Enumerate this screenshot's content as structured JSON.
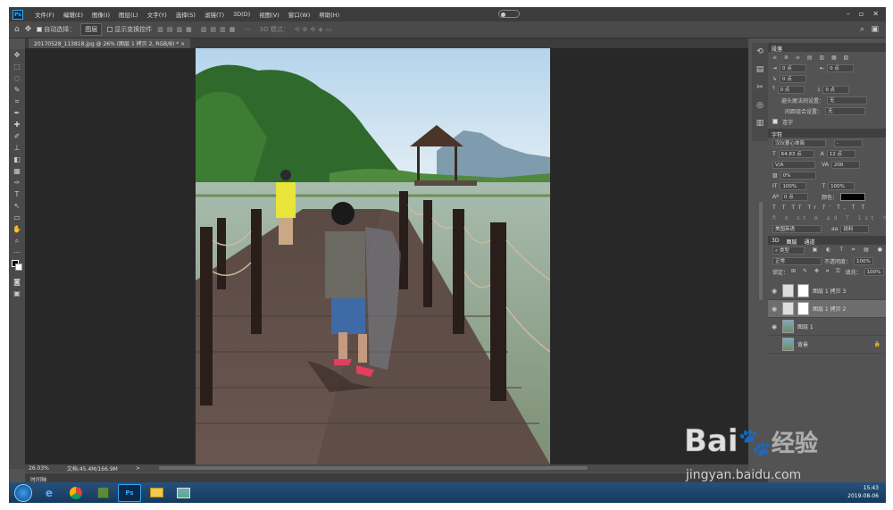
{
  "menubar": {
    "logo": "Ps",
    "items": [
      "文件(F)",
      "编辑(E)",
      "图像(I)",
      "图层(L)",
      "文字(Y)",
      "选择(S)",
      "滤镜(T)",
      "3D(D)",
      "视图(V)",
      "窗口(W)",
      "帮助(H)"
    ],
    "window_controls": [
      "–",
      "▫",
      "✕"
    ]
  },
  "options": {
    "auto_select_label": "自动选择：",
    "auto_select_value": "图层",
    "transform_label": "显示变换控件",
    "mode3d": "3D 模式："
  },
  "document": {
    "tab_title": "20170528_113818.jpg @ 26% (图层 1 拷贝 2, RGB/8) *",
    "close": "×"
  },
  "status": {
    "zoom": "26.03%",
    "doc_info": "文档:45.4M/166.9M",
    "arrow": ">"
  },
  "timeline": {
    "label": "时间轴"
  },
  "paragraph": {
    "title": "段落",
    "indent_left": "0 点",
    "indent_right": "0 点",
    "first_line": "0 点",
    "space_before": "0 点",
    "space_after": "0 点",
    "avoid_label": "避头尾法则设置：",
    "avoid_value": "无",
    "spacing_label": "间距组合设置：",
    "spacing_value": "无",
    "hyphen_label": "连字"
  },
  "character": {
    "title": "字符",
    "font_family": "汉仪菱心体简",
    "font_style": "-",
    "size": "64.83 点",
    "leading": "12 点",
    "kerning": "V/A",
    "tracking": "200",
    "scale_pct": "0%",
    "vscale": "100%",
    "hscale": "100%",
    "baseline": "0 点",
    "color_label": "颜色：",
    "language": "美国英语",
    "antialias": "锐利",
    "glyphs": [
      "T",
      "T",
      "TT",
      "Tr",
      "T'",
      "T,",
      "T",
      "T"
    ]
  },
  "layers_panel": {
    "tabs": [
      "3D",
      "图层",
      "通道"
    ],
    "filter_label": "类型",
    "blend_mode": "正常",
    "opacity_label": "不透明度：",
    "opacity": "100%",
    "lock_label": "锁定：",
    "fill_label": "填充：",
    "fill": "100%",
    "layers": [
      {
        "name": "图层 1 拷贝 3",
        "selected": false
      },
      {
        "name": "图层 1 拷贝 2",
        "selected": true
      },
      {
        "name": "图层 1",
        "selected": false
      },
      {
        "name": "背景",
        "selected": false
      }
    ],
    "lock_icon": "🔒"
  },
  "taskbar": {
    "time": "15:43",
    "date": "2019-08-06",
    "ps_label": "Ps"
  },
  "watermark": {
    "brand": "Bai",
    "brand2": "经验",
    "url": "jingyan.baidu.com"
  },
  "colors": {
    "ps_blue": "#31a8ff",
    "panel": "#535353",
    "canvas_bg": "#282828"
  }
}
